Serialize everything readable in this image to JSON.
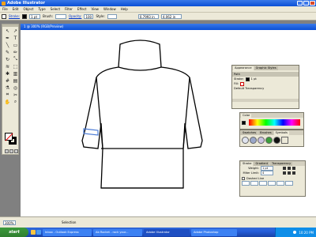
{
  "app": {
    "title": "Adobe Illustrator"
  },
  "menu": [
    "File",
    "Edit",
    "Object",
    "Type",
    "Select",
    "Filter",
    "Effect",
    "View",
    "Window",
    "Help"
  ],
  "control": {
    "stroke_label": "Stroke:",
    "stroke_weight": "1 pt",
    "brush_label": "Brush:",
    "opacity_label": "Opacity:",
    "opacity_value": "100",
    "style_label": "Style:",
    "x_value": "0.7993 in",
    "y_value": "4.062 in"
  },
  "document": {
    "title": "1 @ 300% (RGB/Preview)"
  },
  "panels": {
    "appearance": {
      "tabs": [
        "Appearance",
        "Graphic Styles"
      ],
      "path_label": "Path",
      "stroke_label": "Stroke:",
      "stroke_value": "1 pt",
      "fill_label": "Fill:",
      "default_transparency": "Default Transparency"
    },
    "color": {
      "tabs": [
        "Color"
      ]
    },
    "swatches": {
      "tabs": [
        "Swatches",
        "Brushes",
        "Symbols"
      ]
    },
    "stroke": {
      "tabs": [
        "Stroke",
        "Gradient",
        "Transparency"
      ],
      "weight_label": "Weight:",
      "weight_value": "1 pt",
      "miter_label": "Miter Limit:",
      "miter_value": "4",
      "dashed_label": "Dashed Line"
    }
  },
  "status": {
    "zoom": "300%",
    "mode": "Selection"
  },
  "taskbar": {
    "start": "start",
    "items": [
      "Inbox - Outlook Express",
      "Ab Rocket - rock your...",
      "Adobe Illustrator",
      "Adobe Photoshop"
    ],
    "clock": "10:20 PM"
  },
  "colors": {
    "accent": "#0a4fd6",
    "taskbar": "#245edb",
    "start": "#2f7f2f"
  },
  "icons": [
    "selection-tool-icon",
    "direct-selection-icon",
    "pen-tool-icon",
    "type-tool-icon",
    "line-tool-icon",
    "rectangle-tool-icon",
    "paintbrush-icon",
    "pencil-icon",
    "rotate-icon",
    "scale-icon",
    "warp-icon",
    "free-transform-icon",
    "symbol-sprayer-icon",
    "graph-icon",
    "mesh-icon",
    "gradient-icon",
    "eyedropper-icon",
    "blend-icon",
    "slice-icon",
    "scissors-icon",
    "hand-icon",
    "zoom-icon"
  ]
}
